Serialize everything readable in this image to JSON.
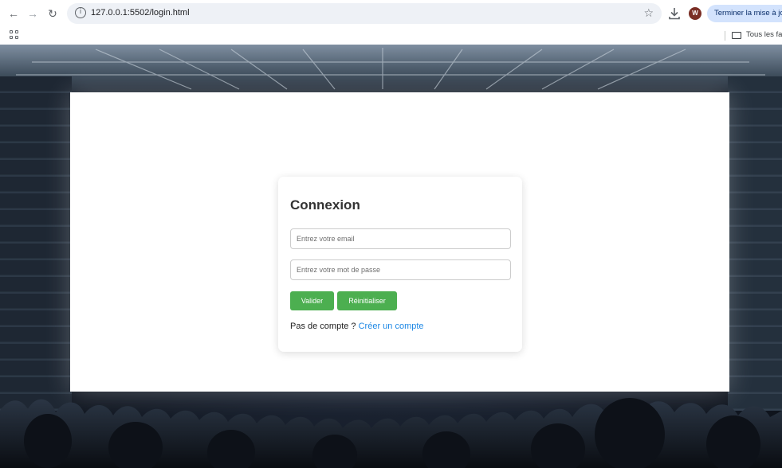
{
  "browser": {
    "url": "127.0.0.1:5502/login.html",
    "update_button": "Terminer la mise à jour",
    "avatar_initial": "W",
    "bookmarks": {
      "all_bookmarks_label": "Tous les favoris"
    }
  },
  "login": {
    "title": "Connexion",
    "email_placeholder": "Entrez votre email",
    "password_placeholder": "Entrez votre mot de passe",
    "submit_label": "Valider",
    "reset_label": "Réinitialiser",
    "no_account_text": "Pas de compte ? ",
    "create_account_link": "Créer un compte"
  },
  "colors": {
    "button_green": "#4caf50",
    "link_blue": "#1e88e5"
  }
}
